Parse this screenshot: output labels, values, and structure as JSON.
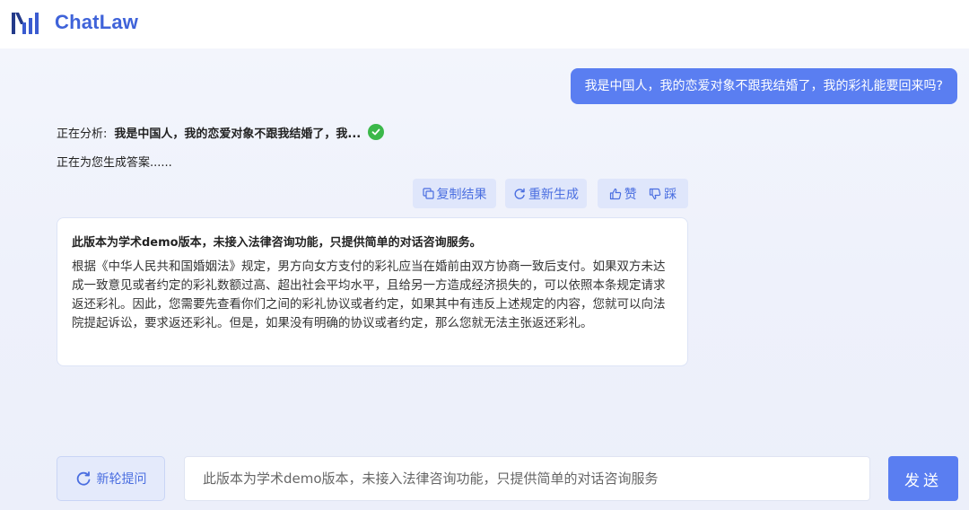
{
  "app": {
    "brand": "ChatLaw"
  },
  "chat": {
    "user_message": "我是中国人，我的恋爱对象不跟我结婚了，我的彩礼能要回来吗?",
    "analysis_prefix": "正在分析:",
    "analysis_query": "我是中国人，我的恋爱对象不跟我结婚了，我...",
    "generating_text": "正在为您生成答案......",
    "actions": {
      "copy_label": "复制结果",
      "regenerate_label": "重新生成",
      "like_label": "赞",
      "dislike_label": "踩"
    },
    "answer": {
      "title": "此版本为学术demo版本，未接入法律咨询功能，只提供简单的对话咨询服务。",
      "body": "根据《中华人民共和国婚姻法》规定，男方向女方支付的彩礼应当在婚前由双方协商一致后支付。如果双方未达成一致意见或者约定的彩礼数额过高、超出社会平均水平，且给另一方造成经济损失的，可以依照本条规定请求返还彩礼。因此，您需要先查看你们之间的彩礼协议或者约定，如果其中有违反上述规定的内容，您就可以向法院提起诉讼，要求返还彩礼。但是，如果没有明确的协议或者约定，那么您就无法主张返还彩礼。"
    }
  },
  "composer": {
    "new_round_label": "新轮提问",
    "placeholder": "此版本为学术demo版本，未接入法律咨询功能，只提供简单的对话咨询服务",
    "send_label": "发送"
  },
  "colors": {
    "accent": "#5a7ef1",
    "brand_text": "#3f63d9",
    "success": "#3bb84a"
  },
  "icons": {
    "logo": "chatlaw-logo-icon",
    "check": "check-circle-icon",
    "copy": "copy-icon",
    "regenerate": "refresh-icon",
    "like": "thumbs-up-icon",
    "dislike": "thumbs-down-icon",
    "new_round": "refresh-icon"
  }
}
